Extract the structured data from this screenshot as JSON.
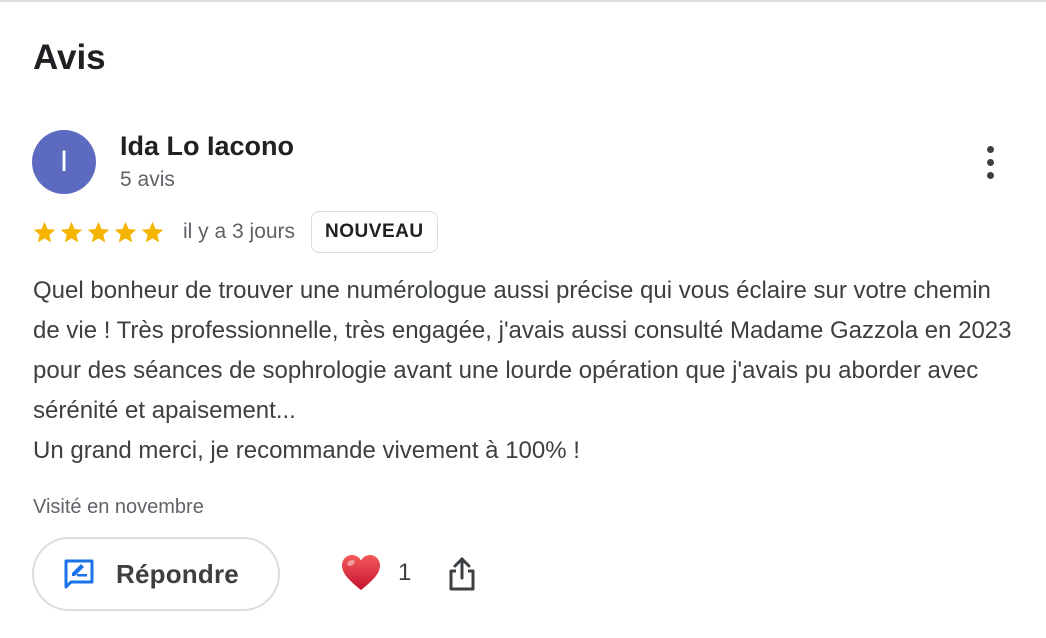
{
  "section": {
    "title": "Avis"
  },
  "review": {
    "author": {
      "initial": "I",
      "name": "Ida Lo Iacono",
      "review_count": "5 avis",
      "avatar_color": "#5c6bc0"
    },
    "rating": 5,
    "rating_max": 5,
    "star_color": "#f4b400",
    "date": "il y a 3 jours",
    "badge": "NOUVEAU",
    "text_lines": [
      "Quel bonheur de trouver une numérologue aussi précise qui vous éclaire sur votre chemin de vie ! Très professionnelle, très engagée, j'avais aussi consulté Madame Gazzola en 2023 pour des séances de sophrologie avant une lourde opération que j'avais pu aborder avec sérénité et apaisement...",
      "Un grand merci, je recommande vivement à 100% !"
    ],
    "visited": "Visité en novembre"
  },
  "actions": {
    "reply_label": "Répondre",
    "reply_icon": "edit-reply-icon",
    "like_icon": "heart-icon",
    "like_count": "1",
    "share_icon": "share-icon",
    "more_icon": "more-vert-icon",
    "accent_color": "#1a73e8"
  }
}
